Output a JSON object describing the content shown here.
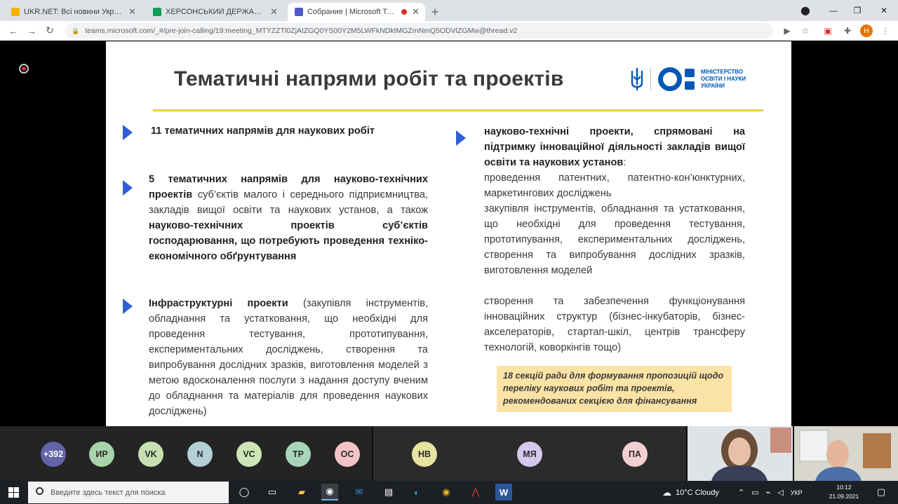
{
  "browser": {
    "tabs": [
      {
        "title": "UKR.NET: Всі новини України, ос...",
        "fav_color": "#f4b400",
        "active": false
      },
      {
        "title": "ХЕРСОНСЬКИЙ ДЕРЖАВНИЙ АГР...",
        "fav_color": "#0f9d58",
        "active": false
      },
      {
        "title": "Собрание | Microsoft Teams",
        "fav_color": "#5059c9",
        "active": true
      }
    ],
    "new_tab": "+",
    "url": "teams.microsoft.com/_#/pre-join-calling/19:meeting_MTYZZTl0ZjAtZGQ0YS00Y2M5LWFkNDktMGZmNmQ5ODVlZGMw@thread.v2",
    "profile_initial": "Н"
  },
  "slide": {
    "title": "Тематичні напрями робіт та проектів",
    "logo_text": [
      "МІНІСТЕРСТВО",
      "ОСВІТИ І НАУКИ",
      "УКРАЇНИ"
    ],
    "left": {
      "b1_bold": "11 тематичних напрямів для наукових робіт",
      "b2_bold1": "5 тематичних напрямів для науково-технічних проектів",
      "b2_text1": " суб’єктів малого і середнього підприємництва, закладів вищої освіти та наукових установ, а також ",
      "b2_bold2": "науково-технічних проектів суб’єктів господарювання, що потребують проведення техніко-економічного обґрунтування",
      "b3_bold": "Інфраструктурні проекти",
      "b3_text": " (закупівля інструментів, обладнання та устатковання, що необхідні для проведення тестування, прототипування, експериментальних досліджень, створення та випробування дослідних зразків, виготовлення моделей з метою вдосконалення послуги з надання доступу вченим до обладнання та матеріалів для проведення наукових досліджень)"
    },
    "right": {
      "bold": "науково-технічні проекти, спрямовані на підтримку інноваційної діяльності закладів вищої освіти та наукових установ",
      "colon": ":",
      "p1": "проведення патентних, патентно-кон’юнктурних, маркетингових досліджень",
      "p2": "закупівля інструментів, обладнання та устатковання, що необхідні для проведення тестування, прототипування, експериментальних досліджень, створення та випробування дослідних зразків, виготовлення моделей",
      "p3": "створення та забезпечення функціонування інноваційних структур (бізнес-інкубаторів, бізнес-акселераторів, стартап-шкіл, центрів трансферу технологій, коворкінгів тощо)"
    },
    "highlight": "18 секцій ради для формування пропозицій щодо переліку наукових робіт та проектів, рекомендованих секцією для фінансування"
  },
  "participants": [
    {
      "label": "+392",
      "color": "#6264a7",
      "text_color": "#ffffff"
    },
    {
      "label": "ИР",
      "color": "#a9d3ab",
      "text_color": "#2b2b2b"
    },
    {
      "label": "VK",
      "color": "#c6e0b4",
      "text_color": "#2b2b2b"
    },
    {
      "label": "N",
      "color": "#b4cfd6",
      "text_color": "#2b2b2b"
    },
    {
      "label": "VC",
      "color": "#cde6b8",
      "text_color": "#2b2b2b"
    },
    {
      "label": "TP",
      "color": "#a8d5b9",
      "text_color": "#2b2b2b"
    },
    {
      "label": "OC",
      "color": "#f2c4c8",
      "text_color": "#2b2b2b"
    },
    {
      "label": "НВ",
      "color": "#e6e2a0",
      "text_color": "#2b2b2b"
    },
    {
      "label": "МЯ",
      "color": "#d4c8ec",
      "text_color": "#2b2b2b"
    },
    {
      "label": "ПА",
      "color": "#f4cfd2",
      "text_color": "#2b2b2b"
    }
  ],
  "taskbar": {
    "search_placeholder": "Введите здесь текст для поиска",
    "weather": "10°C Cloudy",
    "lang": "УКР",
    "time": "10:12",
    "date": "21.09.2021"
  }
}
